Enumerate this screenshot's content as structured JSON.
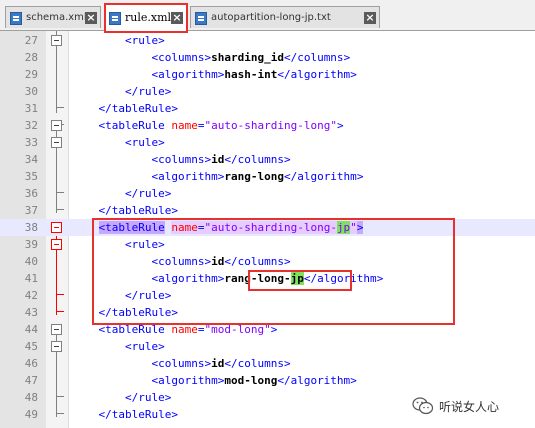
{
  "tabs": [
    {
      "label": "schema.xml",
      "active": false,
      "icon": "xml-file-icon"
    },
    {
      "label": "rule.xml",
      "active": true,
      "icon": "xml-file-icon"
    },
    {
      "label": "autopartition-long-jp.txt",
      "active": false,
      "icon": "txt-file-icon"
    }
  ],
  "editor": {
    "lines": [
      {
        "num": "27",
        "text": "        <rule>"
      },
      {
        "num": "28",
        "text": "            <columns>sharding_id</columns>"
      },
      {
        "num": "29",
        "text": "            <algorithm>hash-int</algorithm>"
      },
      {
        "num": "30",
        "text": "        </rule>"
      },
      {
        "num": "31",
        "text": "    </tableRule>"
      },
      {
        "num": "32",
        "text": "    <tableRule name=\"auto-sharding-long\">"
      },
      {
        "num": "33",
        "text": "        <rule>"
      },
      {
        "num": "34",
        "text": "            <columns>id</columns>"
      },
      {
        "num": "35",
        "text": "            <algorithm>rang-long</algorithm>"
      },
      {
        "num": "36",
        "text": "        </rule>"
      },
      {
        "num": "37",
        "text": "    </tableRule>"
      },
      {
        "num": "38",
        "text": "    <tableRule name=\"auto-sharding-long-jp\">"
      },
      {
        "num": "39",
        "text": "        <rule>"
      },
      {
        "num": "40",
        "text": "            <columns>id</columns>"
      },
      {
        "num": "41",
        "text": "            <algorithm>rang-long-jp</algorithm>"
      },
      {
        "num": "42",
        "text": "        </rule>"
      },
      {
        "num": "43",
        "text": "    </tableRule>"
      },
      {
        "num": "44",
        "text": "    <tableRule name=\"mod-long\">"
      },
      {
        "num": "45",
        "text": "        <rule>"
      },
      {
        "num": "46",
        "text": "            <columns>id</columns>"
      },
      {
        "num": "47",
        "text": "            <algorithm>mod-long</algorithm>"
      },
      {
        "num": "48",
        "text": "        </rule>"
      },
      {
        "num": "49",
        "text": "    </tableRule>"
      }
    ],
    "current_line": "38"
  },
  "watermark": {
    "text": "听说女人心",
    "icon": "wechat-logo-icon"
  },
  "colors": {
    "tag": "#0000ff",
    "attribute": "#ff0000",
    "value": "#8000ff",
    "highlight_box": "#e8302c",
    "word_match": "#80e060"
  }
}
